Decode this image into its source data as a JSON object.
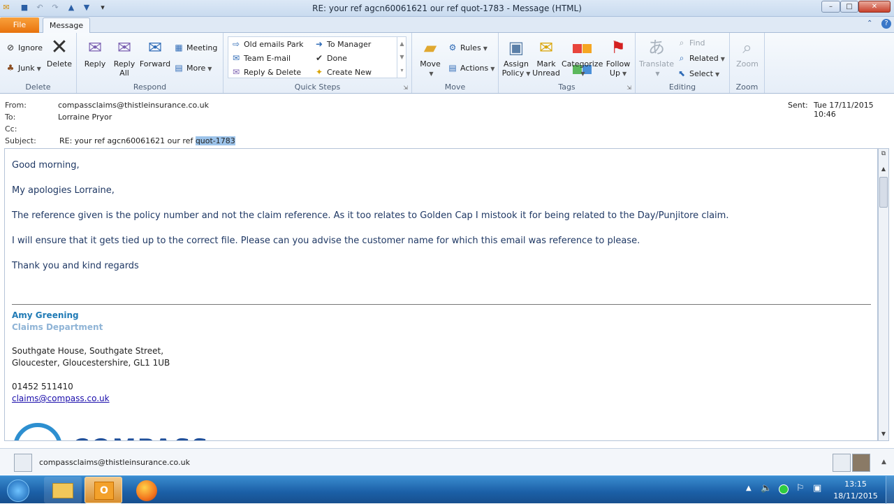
{
  "window": {
    "title": "RE: your ref agcn60061621 our ref quot-1783  -  Message (HTML)",
    "controls": {
      "minimize": "–",
      "maximize": "□",
      "close": "✕"
    }
  },
  "tabs": {
    "file": "File",
    "message": "Message"
  },
  "ribbon": {
    "delete_group": {
      "label": "Delete",
      "ignore": "Ignore",
      "junk": "Junk",
      "delete": "Delete"
    },
    "respond_group": {
      "label": "Respond",
      "reply": "Reply",
      "reply_all_1": "Reply",
      "reply_all_2": "All",
      "forward": "Forward",
      "meeting": "Meeting",
      "more": "More"
    },
    "quicksteps_group": {
      "label": "Quick Steps",
      "items": [
        "Old emails Park",
        "Team E-mail",
        "Reply & Delete",
        "To Manager",
        "Done",
        "Create New"
      ]
    },
    "move_group": {
      "label": "Move",
      "move": "Move",
      "rules": "Rules",
      "actions": "Actions"
    },
    "tags_group": {
      "label": "Tags",
      "assign_policy_1": "Assign",
      "assign_policy_2": "Policy",
      "mark_unread_1": "Mark",
      "mark_unread_2": "Unread",
      "categorize": "Categorize",
      "follow_up_1": "Follow",
      "follow_up_2": "Up"
    },
    "editing_group": {
      "label": "Editing",
      "translate": "Translate",
      "find": "Find",
      "related": "Related",
      "select": "Select"
    },
    "zoom_group": {
      "label": "Zoom",
      "zoom": "Zoom"
    }
  },
  "header": {
    "from_label": "From:",
    "from": "compassclaims@thistleinsurance.co.uk",
    "to_label": "To:",
    "to": "Lorraine Pryor",
    "cc_label": "Cc:",
    "subject_label": "Subject:",
    "subject": "RE: your ref agcn60061621 our ref ",
    "subject_highlight": "quot-1783",
    "sent_label": "Sent:",
    "sent": "Tue 17/11/2015 10:46"
  },
  "body": {
    "greeting": "Good morning,",
    "apology": "My apologies Lorraine,",
    "para1": "The reference given is the policy number and not the claim reference. As it too relates to Golden Cap I mistook it for being related to the Day/Punjitore claim.",
    "para2": "I will ensure that it gets tied up to the correct file. Please can you advise the customer name for which this email was reference to please.",
    "closing": "Thank you and kind regards",
    "sig_name": "Amy Greening",
    "sig_dept": "Claims Department",
    "addr1": "Southgate House, Southgate Street,",
    "addr2": "Gloucester, Gloucestershire, GL1 1UB",
    "phone": "01452 511410",
    "email": "claims@compass.co.uk",
    "logo_text": "COMPASS"
  },
  "people_pane": {
    "sender": "compassclaims@thistleinsurance.co.uk"
  },
  "taskbar": {
    "time": "13:15",
    "date": "18/11/2015"
  },
  "colors": {
    "accent": "#2b579a",
    "file_tab": "#e8730d",
    "body_text": "#1f3864",
    "sig_name": "#1f7ab5",
    "sig_dept": "#8fb4d6",
    "highlight": "#9cc3ea"
  }
}
